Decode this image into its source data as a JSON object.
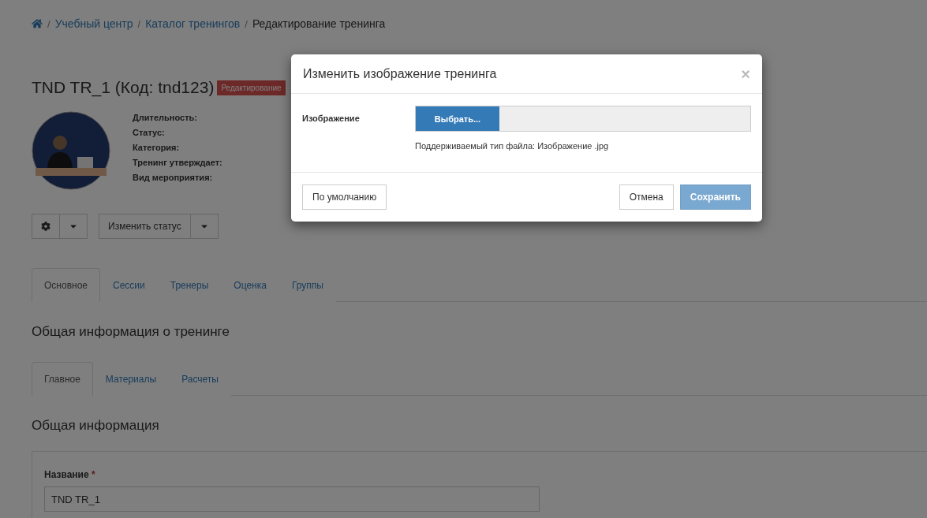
{
  "breadcrumb": {
    "separator": "/",
    "items": [
      {
        "label": "Учебный центр",
        "kind": "link"
      },
      {
        "label": "Каталог тренингов",
        "kind": "link"
      },
      {
        "label": "Редактирование тренинга",
        "kind": "current"
      }
    ]
  },
  "training": {
    "title": "TND TR_1 (Код: tnd123)",
    "badge": "Редактирование",
    "fields": [
      "Длительность:",
      "Статус:",
      "Категория:",
      "Тренинг утверждает:",
      "Вид мероприятия:"
    ]
  },
  "actions": {
    "status_button": "Изменить статус"
  },
  "tabs": [
    {
      "label": "Основное",
      "selected": true
    },
    {
      "label": "Сессии",
      "selected": false
    },
    {
      "label": "Тренеры",
      "selected": false
    },
    {
      "label": "Оценка",
      "selected": false
    },
    {
      "label": "Группы",
      "selected": false
    }
  ],
  "section_title": "Общая информация о тренинге",
  "subtabs": [
    {
      "label": "Главное",
      "selected": true
    },
    {
      "label": "Материалы",
      "selected": false
    },
    {
      "label": "Расчеты",
      "selected": false
    }
  ],
  "subsection_title": "Общая информация",
  "form": {
    "name_label": "Название",
    "required_mark": "*",
    "name_value": "TND TR_1"
  },
  "modal": {
    "title": "Изменить изображение тренинга",
    "close": "×",
    "field_label": "Изображение",
    "choose_button": "Выбрать...",
    "hint": "Поддерживаемый тип файла: Изображение .jpg",
    "default_button": "По умолчанию",
    "cancel_button": "Отмена",
    "save_button": "Сохранить",
    "save_disabled": true
  }
}
